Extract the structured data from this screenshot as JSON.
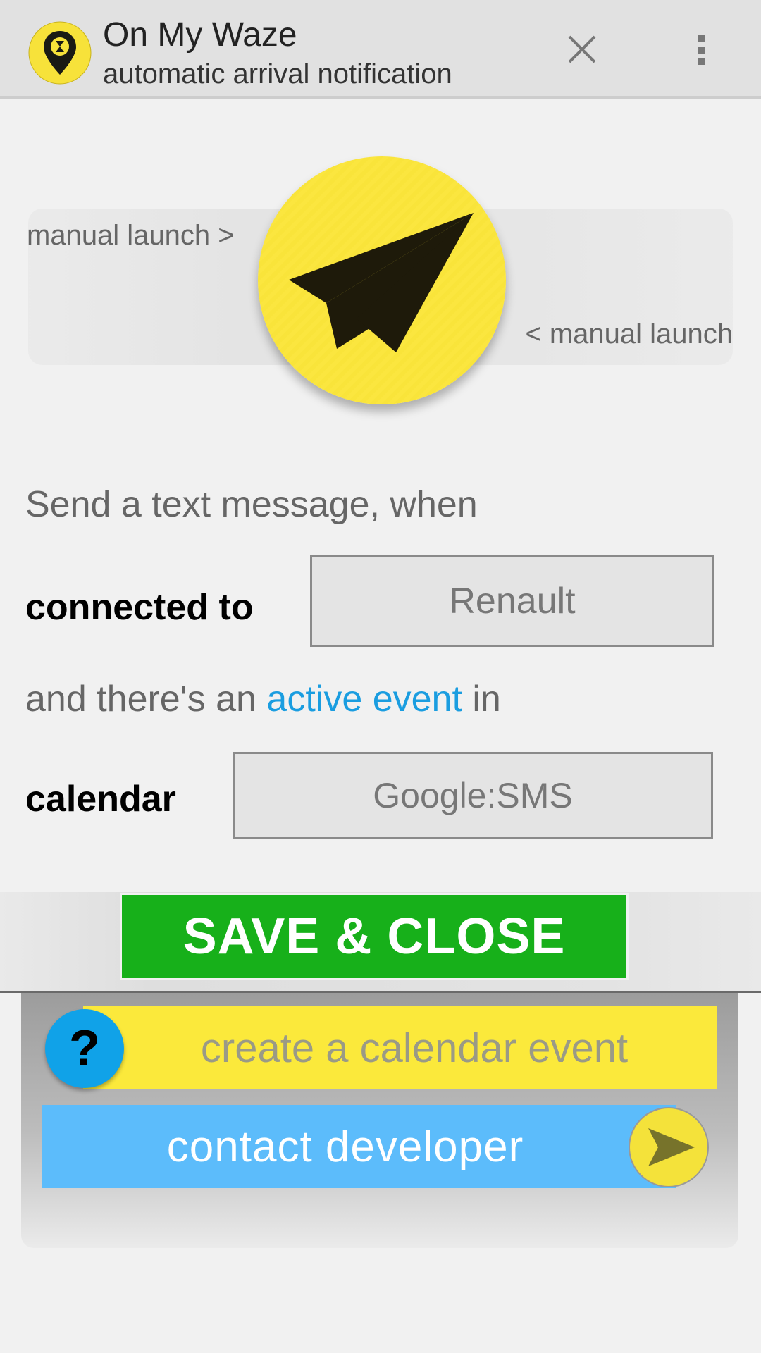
{
  "header": {
    "title": "On My Waze",
    "subtitle": "automatic arrival notification",
    "icons": [
      "app-logo-icon",
      "close-icon",
      "overflow-menu-icon"
    ]
  },
  "launch": {
    "left_label": "manual launch >",
    "right_label": "< manual launch",
    "button_icon": "paper-plane-icon"
  },
  "form": {
    "intro": "Send a text message, when",
    "connected_label": "connected to",
    "connected_value": "Renault",
    "event_prefix": "and there's an",
    "event_link": "active event",
    "event_suffix": "in",
    "calendar_label": "calendar",
    "calendar_value": "Google:SMS"
  },
  "actions": {
    "save_label": "SAVE & CLOSE",
    "create_event_label": "create a calendar event",
    "help_symbol": "?",
    "contact_label": "contact developer",
    "contact_icon": "send-arrow-icon"
  },
  "colors": {
    "save": "#17b01a",
    "yellow": "#fbe93b",
    "blue": "#5cbcfb",
    "link": "#1a9de0"
  }
}
